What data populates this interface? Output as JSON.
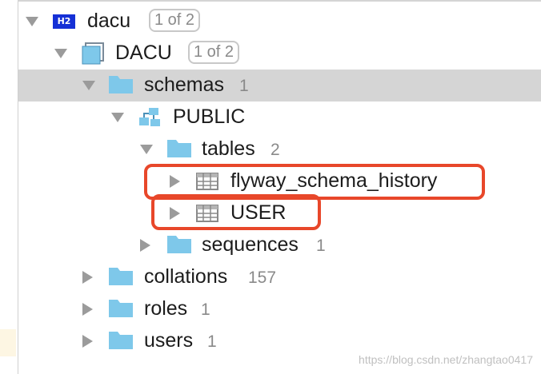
{
  "tree": {
    "nodes": [
      {
        "id": "dacu",
        "label": "dacu",
        "badge": "1 of 2",
        "icon": "h2-database-icon",
        "icon_text": "H2"
      },
      {
        "id": "dacu-schema",
        "label": "DACU",
        "badge": "1 of 2",
        "icon": "database-schema-icon"
      },
      {
        "id": "schemas",
        "label": "schemas",
        "count": "1",
        "icon": "folder-icon"
      },
      {
        "id": "public",
        "label": "PUBLIC",
        "icon": "schema-icon"
      },
      {
        "id": "tables",
        "label": "tables",
        "count": "2",
        "icon": "folder-icon"
      },
      {
        "id": "flyway",
        "label": "flyway_schema_history",
        "icon": "table-icon"
      },
      {
        "id": "user",
        "label": "USER",
        "icon": "table-icon"
      },
      {
        "id": "sequences",
        "label": "sequences",
        "count": "1",
        "icon": "folder-icon"
      },
      {
        "id": "collations",
        "label": "collations",
        "count": "157",
        "icon": "folder-icon"
      },
      {
        "id": "roles",
        "label": "roles",
        "count": "1",
        "icon": "folder-icon"
      },
      {
        "id": "users",
        "label": "users",
        "count": "1",
        "icon": "folder-icon"
      }
    ],
    "selected": "schemas"
  },
  "watermark": "https://blog.csdn.net/zhangtao0417",
  "colors": {
    "folder": "#7ec8ea",
    "selection": "#d5d5d5",
    "highlight": "#e8472a",
    "h2_icon": "#1530d6",
    "arrow": "#9b9b9b"
  }
}
